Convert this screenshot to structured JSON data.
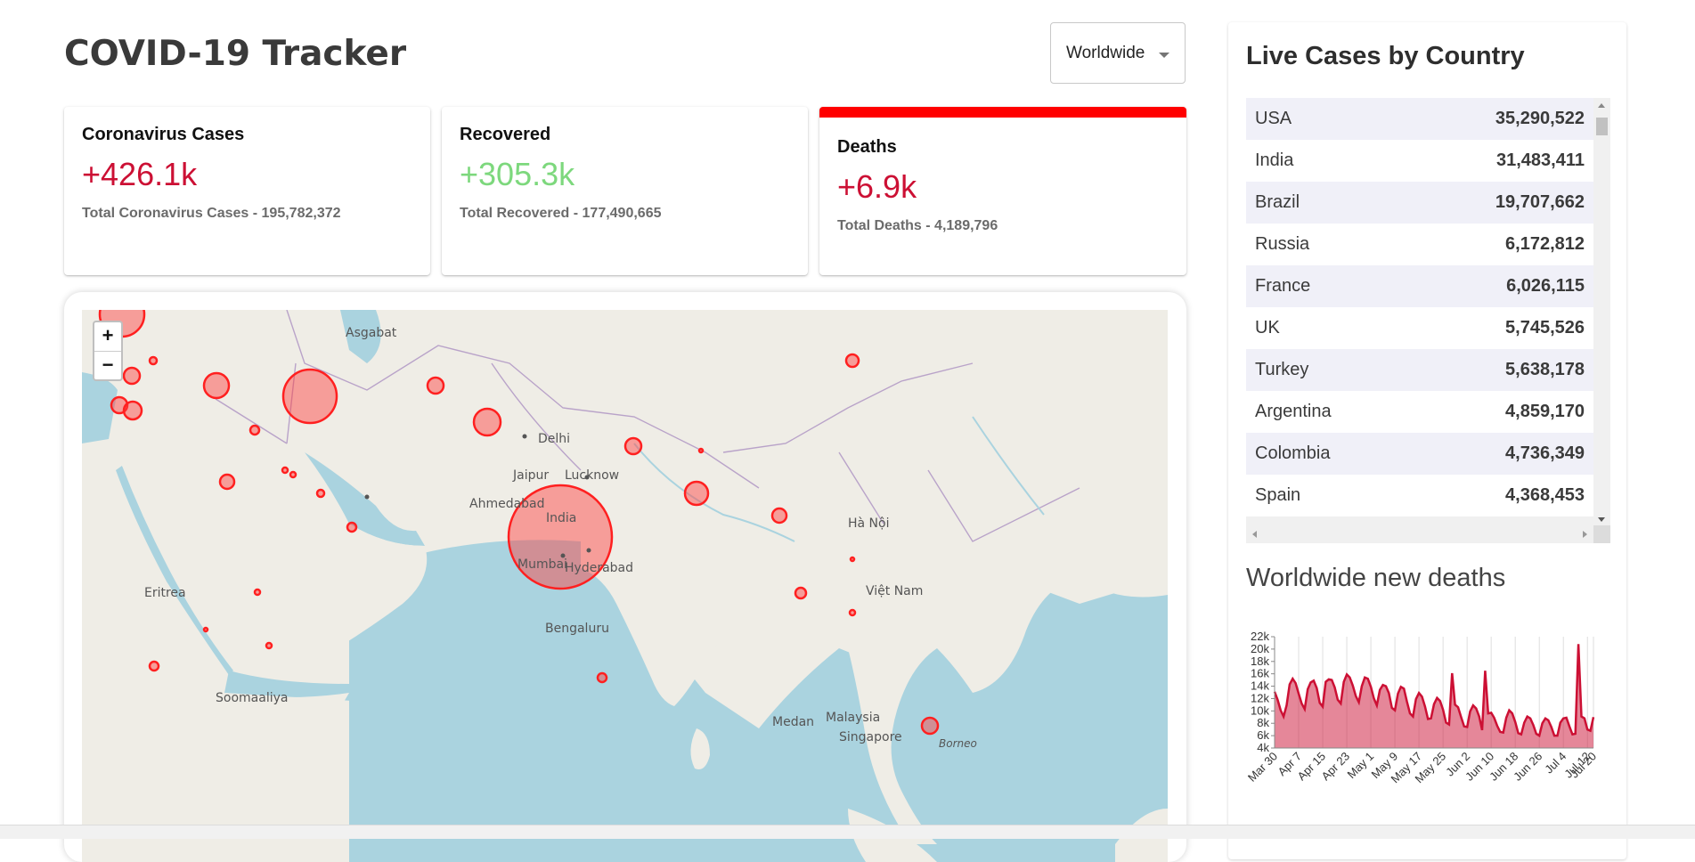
{
  "header": {
    "title": "COVID-19 Tracker",
    "country_select": {
      "value": "Worldwide"
    }
  },
  "infoboxes": {
    "cases": {
      "title": "Coronavirus Cases",
      "value": "+426.1k",
      "total": "Total Coronavirus Cases - 195,782,372"
    },
    "recovered": {
      "title": "Recovered",
      "value": "+305.3k",
      "total": "Total Recovered - 177,490,665"
    },
    "deaths": {
      "title": "Deaths",
      "value": "+6.9k",
      "total": "Total Deaths - 4,189,796"
    }
  },
  "colors": {
    "cases": "#cc1034",
    "recovered": "#7dd87d",
    "deaths_selected_border": "#ff0000"
  },
  "map": {
    "zoom_in": "+",
    "zoom_out": "−",
    "labels": [
      "India",
      "Mumbai",
      "Hyderabad",
      "Bengaluru",
      "Delhi",
      "Jaipur",
      "Lucknow",
      "Ahmedabad",
      "Medan",
      "Malaysia",
      "Singapore",
      "Việt Nam",
      "Hà Nội",
      "Borneo",
      "Soomaaliya",
      "Asgabat",
      "Eritrea"
    ]
  },
  "right_panel": {
    "title": "Live Cases by Country",
    "countries": [
      {
        "name": "USA",
        "cases": "35,290,522"
      },
      {
        "name": "India",
        "cases": "31,483,411"
      },
      {
        "name": "Brazil",
        "cases": "19,707,662"
      },
      {
        "name": "Russia",
        "cases": "6,172,812"
      },
      {
        "name": "France",
        "cases": "6,026,115"
      },
      {
        "name": "UK",
        "cases": "5,745,526"
      },
      {
        "name": "Turkey",
        "cases": "5,638,178"
      },
      {
        "name": "Argentina",
        "cases": "4,859,170"
      },
      {
        "name": "Colombia",
        "cases": "4,736,349"
      },
      {
        "name": "Spain",
        "cases": "4,368,453"
      }
    ]
  },
  "chart_title": "Worldwide new deaths",
  "chart_data": {
    "type": "area",
    "title": "Worldwide new deaths",
    "xlabel": "",
    "ylabel": "",
    "ylim": [
      4000,
      22000
    ],
    "y_ticks": [
      "4k",
      "6k",
      "8k",
      "10k",
      "12k",
      "14k",
      "16k",
      "18k",
      "20k",
      "22k"
    ],
    "x_ticks": [
      "Mar 30",
      "Apr 7",
      "Apr 15",
      "Apr 23",
      "May 1",
      "May 9",
      "May 17",
      "May 25",
      "Jun 2",
      "Jun 10",
      "Jun 18",
      "Jun 26",
      "Jul 4",
      "Jul 12",
      "Jul 20"
    ],
    "x_start": "2021-03-30",
    "line_color": "#cc1034",
    "fill_color": "rgba(204,16,52,0.5)",
    "values": [
      13100,
      11800,
      10100,
      9100,
      10900,
      14300,
      15200,
      14500,
      12800,
      11200,
      10300,
      13500,
      14600,
      14900,
      13700,
      11300,
      10700,
      14700,
      15100,
      15000,
      13800,
      11800,
      11200,
      14700,
      15900,
      15400,
      14100,
      12400,
      11400,
      14000,
      15400,
      15200,
      13900,
      12000,
      10900,
      13400,
      14200,
      14000,
      12900,
      10500,
      10100,
      12800,
      13900,
      13600,
      11500,
      9600,
      9100,
      11900,
      12900,
      12300,
      10700,
      8700,
      8800,
      11100,
      12100,
      11600,
      10200,
      8100,
      7800,
      16100,
      11000,
      10600,
      9000,
      7500,
      7400,
      9900,
      10900,
      10400,
      9100,
      6900,
      16500,
      9600,
      9700,
      8900,
      7600,
      6600,
      6500,
      8900,
      10100,
      9600,
      8200,
      6400,
      6200,
      8100,
      9100,
      8800,
      7700,
      6300,
      6000,
      8000,
      8800,
      8500,
      7400,
      6000,
      6000,
      8100,
      8800,
      8900,
      7500,
      6200,
      6300,
      20800,
      9100,
      8800,
      7000,
      6800,
      9000
    ]
  }
}
